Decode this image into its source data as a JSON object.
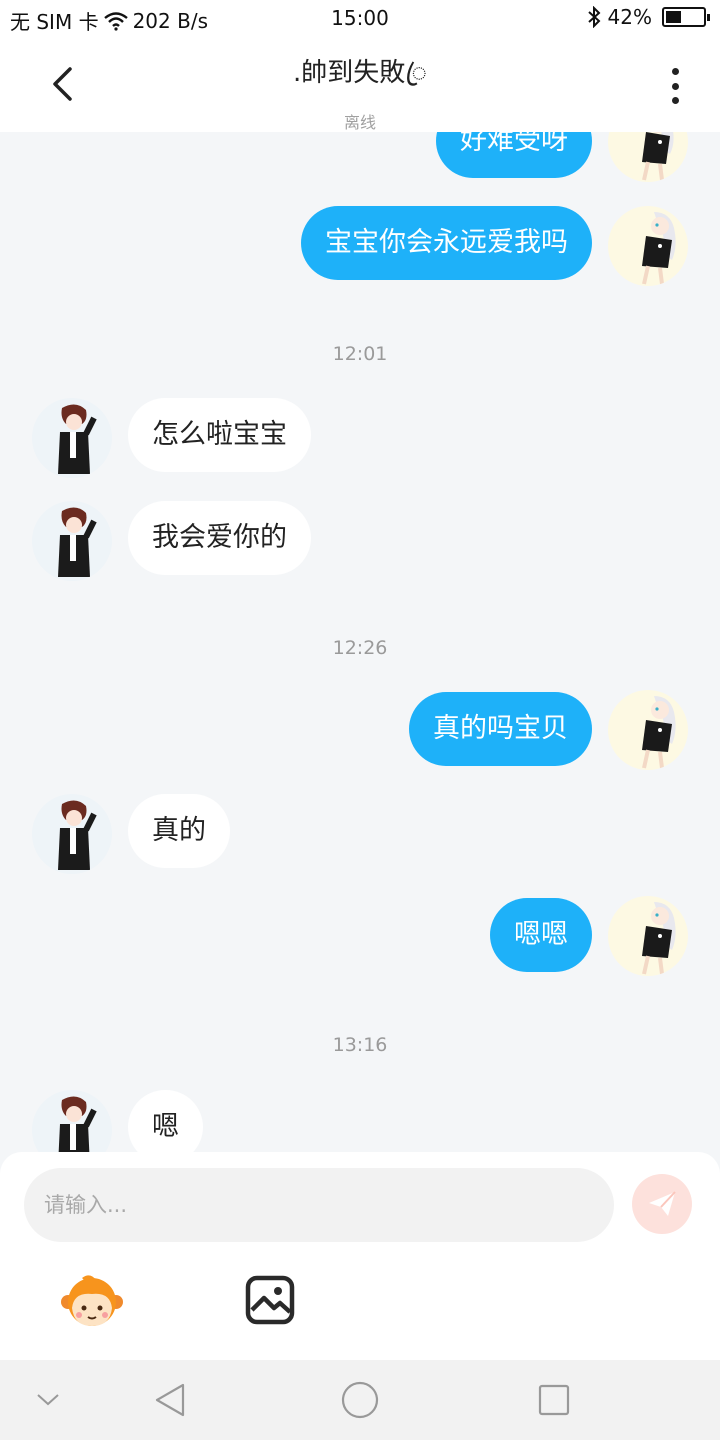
{
  "status_bar": {
    "carrier": "无 SIM 卡",
    "net_speed": "202 B/s",
    "time": "15:00",
    "battery_percent": "42%",
    "battery_level": 0.42
  },
  "header": {
    "title": ".帥到失敗ꦿ",
    "status": "离线"
  },
  "messages": [
    {
      "sender": "me",
      "text": "好难受呀"
    },
    {
      "sender": "me",
      "text": "宝宝你会永远爱我吗"
    },
    {
      "type": "time",
      "text": "12:01"
    },
    {
      "sender": "them",
      "text": "怎么啦宝宝"
    },
    {
      "sender": "them",
      "text": "我会爱你的"
    },
    {
      "type": "time",
      "text": "12:26"
    },
    {
      "sender": "me",
      "text": "真的吗宝贝"
    },
    {
      "sender": "them",
      "text": "真的"
    },
    {
      "sender": "me",
      "text": "嗯嗯"
    },
    {
      "type": "time",
      "text": "13:16"
    },
    {
      "sender": "them",
      "text": "嗯"
    }
  ],
  "input": {
    "placeholder": "请输入..."
  },
  "icons": {
    "send": "send-icon",
    "emoji": "emoji-monkey-icon",
    "image": "image-icon",
    "back": "back-icon",
    "more": "more-vertical-icon"
  },
  "colors": {
    "my_bubble": "#1eb1f9",
    "their_bubble": "#ffffff",
    "background": "#f4f6f8",
    "send_button": "#fde1dc"
  }
}
